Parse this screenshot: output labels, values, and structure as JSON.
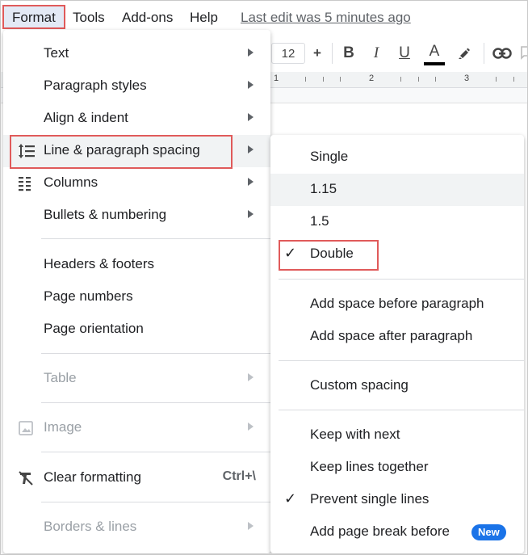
{
  "menubar": {
    "format": "Format",
    "tools": "Tools",
    "addons": "Add-ons",
    "help": "Help",
    "last_edit": "Last edit was 5 minutes ago"
  },
  "toolbar": {
    "font_size": "12",
    "plus": "+",
    "bold": "B",
    "italic": "I",
    "underline": "U",
    "text_color": "A"
  },
  "ruler": {
    "marks": [
      "1",
      "2",
      "3"
    ]
  },
  "format_menu": {
    "items": [
      {
        "label": "Text"
      },
      {
        "label": "Paragraph styles"
      },
      {
        "label": "Align & indent"
      },
      {
        "label": "Line & paragraph spacing"
      },
      {
        "label": "Columns"
      },
      {
        "label": "Bullets & numbering"
      },
      {
        "label": "Headers & footers"
      },
      {
        "label": "Page numbers"
      },
      {
        "label": "Page orientation"
      },
      {
        "label": "Table"
      },
      {
        "label": "Image"
      },
      {
        "label": "Clear formatting",
        "shortcut": "Ctrl+\\"
      },
      {
        "label": "Borders & lines"
      }
    ]
  },
  "spacing_submenu": {
    "items": [
      {
        "label": "Single"
      },
      {
        "label": "1.15"
      },
      {
        "label": "1.5"
      },
      {
        "label": "Double"
      },
      {
        "label": "Add space before paragraph"
      },
      {
        "label": "Add space after paragraph"
      },
      {
        "label": "Custom spacing"
      },
      {
        "label": "Keep with next"
      },
      {
        "label": "Keep lines together"
      },
      {
        "label": "Prevent single lines"
      },
      {
        "label": "Add page break before"
      }
    ],
    "new_badge": "New",
    "check_glyph": "✓"
  },
  "colors": {
    "highlight_box": "#e05a5a",
    "accent_blue": "#1a73e8",
    "hover_bg": "#f1f3f4"
  }
}
